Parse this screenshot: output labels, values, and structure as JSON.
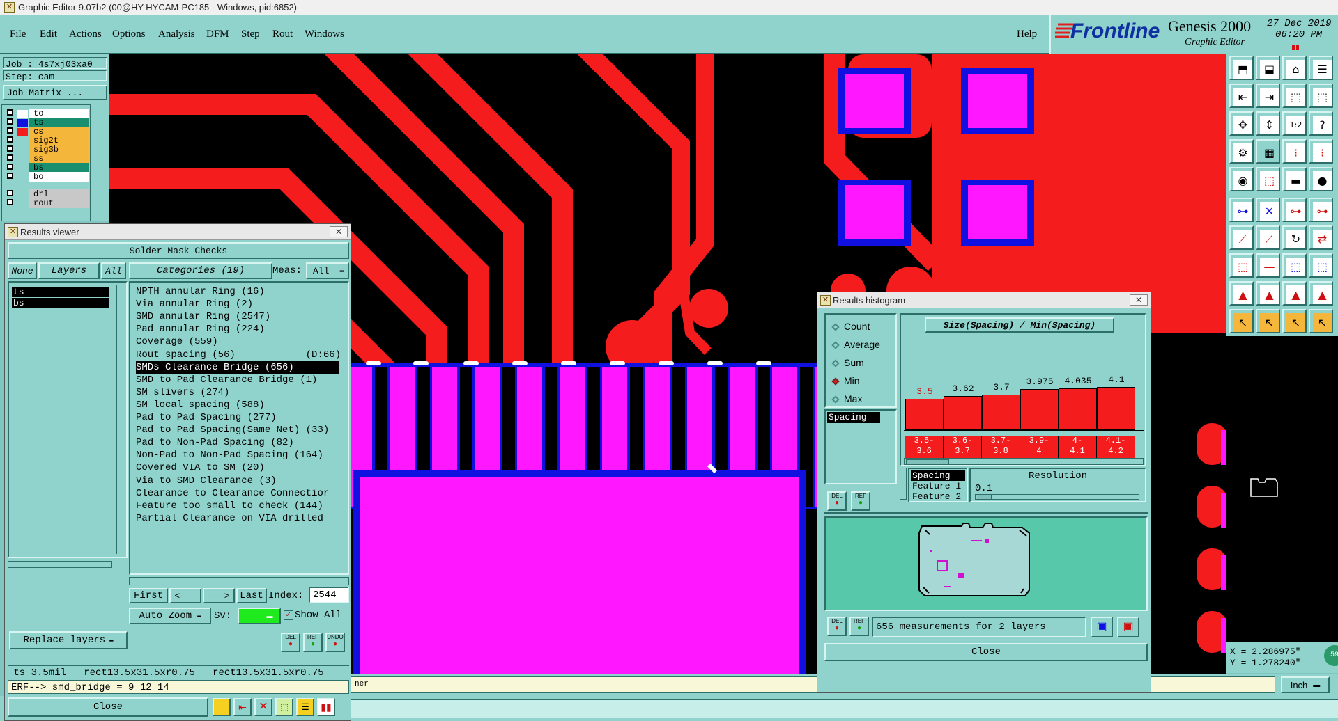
{
  "window": {
    "title": "Graphic Editor 9.07b2 (00@HY-HYCAM-PC185 - Windows, pid:6852)"
  },
  "menu": [
    "File",
    "Edit",
    "Actions",
    "Options",
    "Analysis",
    "DFM",
    "Step",
    "Rout",
    "Windows"
  ],
  "help_label": "Help",
  "brand": {
    "logo": "Frontline",
    "product": "Genesis 2000",
    "subtitle": "Graphic Editor",
    "date": "27 Dec 2019",
    "time": "06:20 PM"
  },
  "job": {
    "job_line": "Job : 4s7xj03xa0",
    "step_line": "Step: cam",
    "matrix_button": "Job Matrix ..."
  },
  "layers": [
    {
      "name": "to",
      "color": "#ffffff",
      "swatch": "#ffffff"
    },
    {
      "name": "ts",
      "color": "#1a8f6f",
      "swatch": "#1010e0"
    },
    {
      "name": "cs",
      "color": "#f5b63c",
      "swatch": "#f41c1c"
    },
    {
      "name": "sig2t",
      "color": "#f5b63c",
      "swatch": "#8fd3cc"
    },
    {
      "name": "sig3b",
      "color": "#f5b63c",
      "swatch": "#8fd3cc"
    },
    {
      "name": "ss",
      "color": "#f5b63c",
      "swatch": "#8fd3cc"
    },
    {
      "name": "bs",
      "color": "#1a8f6f",
      "swatch": "#8fd3cc"
    },
    {
      "name": "bo",
      "color": "#ffffff",
      "swatch": "#8fd3cc"
    },
    {
      "name": "drl",
      "color": "#c8c8c8",
      "swatch": "#8fd3cc"
    },
    {
      "name": "rout",
      "color": "#c8c8c8",
      "swatch": "#8fd3cc"
    }
  ],
  "results_viewer": {
    "title": "Results viewer",
    "header": "Solder Mask Checks",
    "none_label": "None",
    "layers_label": "Layers",
    "all_label": "All",
    "categories_label": "Categories (19)",
    "meas_label": "Meas:",
    "meas_value": "All",
    "layer_list": [
      "ts",
      "bs"
    ],
    "categories": [
      "NPTH annular Ring (16)",
      "Via annular Ring (2)",
      "SMD annular Ring (2547)",
      "Pad annular Ring (224)",
      "Coverage (559)",
      "Rout spacing (56)            (D:66)",
      "SMDs Clearance Bridge (656)",
      "SMD to Pad Clearance Bridge (1)",
      "SM slivers (274)",
      "SM local spacing (588)",
      "Pad to Pad Spacing (277)",
      "Pad to Pad Spacing(Same Net) (33)",
      "Pad to Non-Pad Spacing (82)",
      "Non-Pad to Non-Pad Spacing (164)",
      "Covered VIA to SM (20)",
      "Via to SMD Clearance (3)",
      "Clearance to Clearance Connectior",
      "Feature too small to check (144)",
      "Partial Clearance on VIA drilled"
    ],
    "selected_index": 6,
    "nav": {
      "first": "First",
      "prev": "<---",
      "next": "--->",
      "last": "Last",
      "index_label": "Index:",
      "index_value": "2544"
    },
    "auto_zoom": "Auto Zoom",
    "sv_label": "Sv:",
    "show_all": "Show All",
    "replace_layers": "Replace layers",
    "info_line": " ts 3.5mil   rect13.5x31.5xr0.75   rect13.5x31.5xr0.75",
    "erf_line": "ERF--> smd_bridge = 9 12 14",
    "close": "Close",
    "small_buttons": [
      "DEL",
      "REF",
      "UNDO"
    ]
  },
  "histogram": {
    "title": "Results histogram",
    "options": [
      {
        "label": "Count",
        "selected": false
      },
      {
        "label": "Average",
        "selected": false
      },
      {
        "label": "Sum",
        "selected": false
      },
      {
        "label": "Min",
        "selected": true
      },
      {
        "label": "Max",
        "selected": false
      }
    ],
    "list_item": "Spacing",
    "chart_title": "Size(Spacing) / Min(Spacing)",
    "bin_labels": [
      "3.5",
      "3.62",
      "3.7",
      "3.975",
      "4.035",
      "4.1"
    ],
    "bin_ranges": [
      [
        "3.5-",
        "3.6"
      ],
      [
        "3.6-",
        "3.7"
      ],
      [
        "3.7-",
        "3.8"
      ],
      [
        "3.9-",
        "4"
      ],
      [
        "4-",
        "4.1"
      ],
      [
        "4.1-",
        "4.2"
      ]
    ],
    "selectors": [
      "Spacing",
      "Feature 1",
      "Feature 2"
    ],
    "resolution_label": "Resolution",
    "resolution_value": "0.1",
    "measurements": "656 measurements for 2 layers",
    "close": "Close",
    "small_buttons": [
      "DEL",
      "REF"
    ]
  },
  "chart_data": {
    "type": "bar",
    "title": "Size(Spacing) / Min(Spacing)",
    "categories": [
      "3.5-3.6",
      "3.6-3.7",
      "3.7-3.8",
      "3.9-4",
      "4-4.1",
      "4.1-4.2"
    ],
    "series": [
      {
        "values": [
          3.5,
          3.62,
          3.7,
          3.975,
          4.035,
          4.1
        ]
      }
    ]
  },
  "coords": {
    "x": "X = 2.286975\"",
    "y": "Y = 1.278240\""
  },
  "units": "Inch",
  "status_fragment": "ner"
}
